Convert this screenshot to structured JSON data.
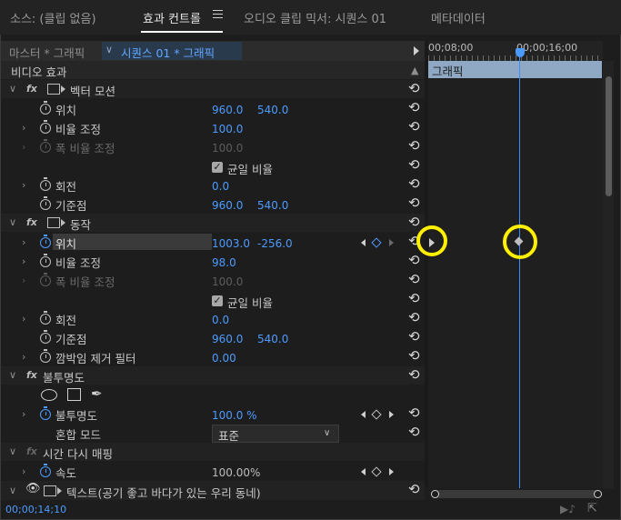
{
  "tabs": [
    {
      "label": "소스: (클립 없음)",
      "active": false
    },
    {
      "label": "효과 컨트롤",
      "active": true
    },
    {
      "label": "오디오 클립 믹서: 시퀀스 01",
      "active": false
    },
    {
      "label": "메타데이터",
      "active": false
    }
  ],
  "header": {
    "master_label": "마스터 * 그래픽",
    "sequence_label": "시퀀스 01 * 그래픽"
  },
  "timeline": {
    "timecode_start": "00;08;00",
    "timecode_mid": "00;00;16;00",
    "clip_label": "그래픽",
    "current_timecode": "00;00;14;10"
  },
  "section_label": "비디오 효과",
  "effects": {
    "vector_motion": {
      "name": "벡터 모션",
      "position_label": "위치",
      "position_x": "960.0",
      "position_y": "540.0",
      "scale_label": "비율 조정",
      "scale_value": "100.0",
      "scale_width_label": "폭 비율 조정",
      "scale_width_value": "100.0",
      "uniform_label": "균일 비율",
      "rotation_label": "회전",
      "rotation_value": "0.0",
      "anchor_label": "기준점",
      "anchor_x": "960.0",
      "anchor_y": "540.0"
    },
    "motion": {
      "name": "동작",
      "position_label": "위치",
      "position_x": "1003.0",
      "position_y": "-256.0",
      "scale_label": "비율 조정",
      "scale_value": "98.0",
      "scale_width_label": "폭 비율 조정",
      "scale_width_value": "100.0",
      "uniform_label": "균일 비율",
      "rotation_label": "회전",
      "rotation_value": "0.0",
      "anchor_label": "기준점",
      "anchor_x": "960.0",
      "anchor_y": "540.0",
      "antiflicker_label": "깜박임 제거 필터",
      "antiflicker_value": "0.00"
    },
    "opacity": {
      "name": "불투명도",
      "opacity_label": "불투명도",
      "opacity_value": "100.0 %",
      "blend_label": "혼합 모드",
      "blend_value": "표준"
    },
    "time_remap": {
      "name": "시간 다시 매핑",
      "speed_label": "속도",
      "speed_value": "100.00%"
    },
    "text": {
      "name": "텍스트(공기 좋고 바다가 있는 우리 동네)"
    }
  },
  "colors": {
    "accent_blue": "#4c9bff",
    "highlight_yellow": "#ffef00",
    "clip_color": "#8fa9c4"
  }
}
